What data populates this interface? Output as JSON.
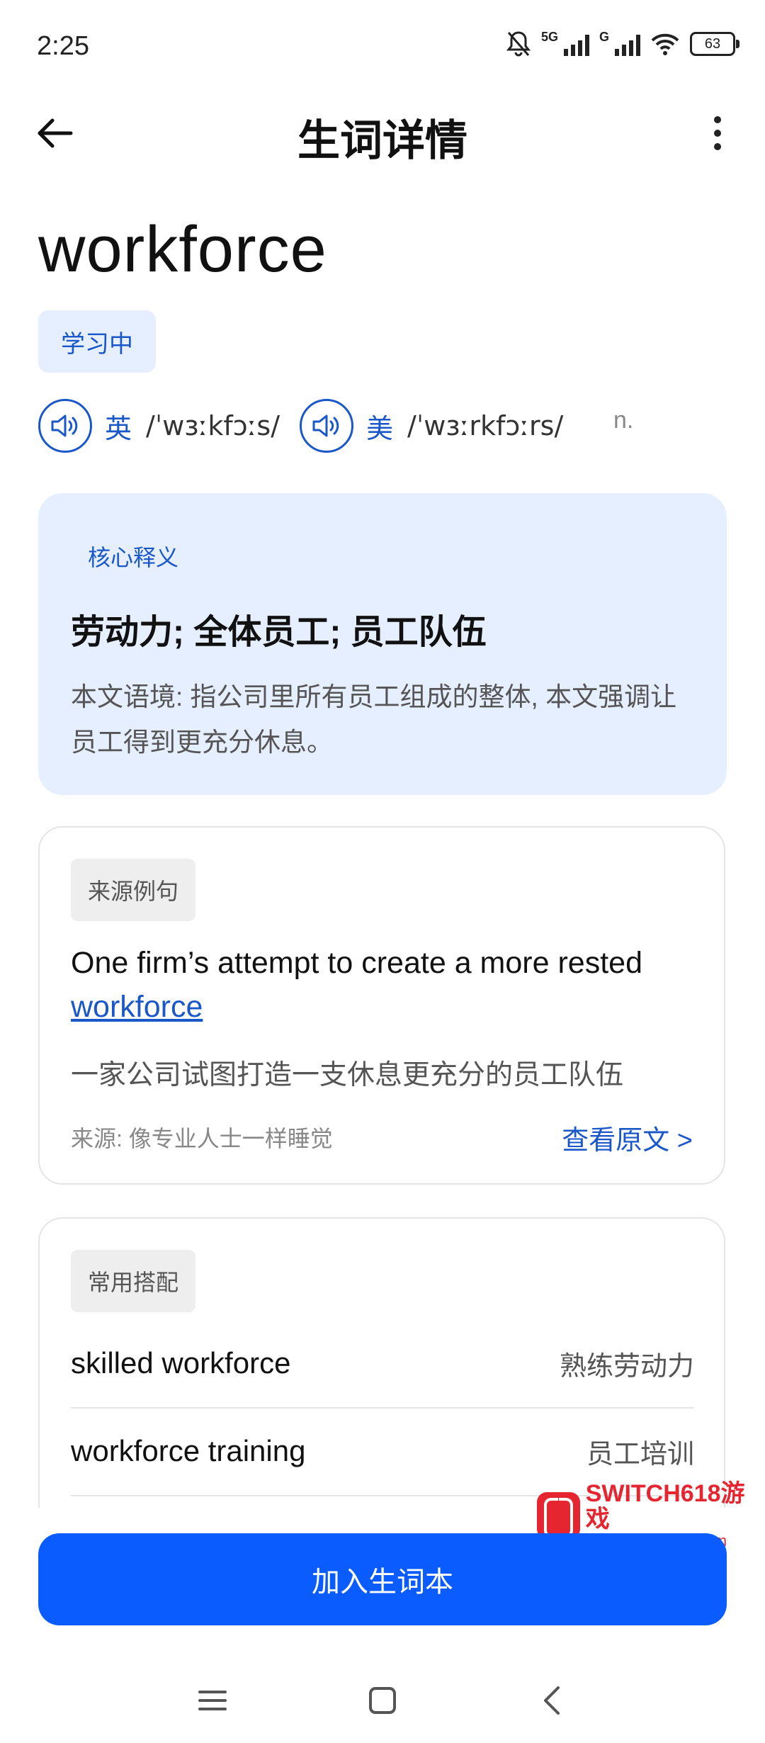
{
  "status_bar": {
    "time": "2:25",
    "network_1": "5G",
    "network_2": "G",
    "battery": "63"
  },
  "header": {
    "title": "生词详情"
  },
  "word": {
    "text": "workforce",
    "status": "学习中",
    "uk_label": "英",
    "uk_ipa": "/ˈwɜːkfɔːs/",
    "us_label": "美",
    "us_ipa": "/ˈwɜːrkfɔːrs/",
    "pos": "n."
  },
  "core": {
    "label": "核心释义",
    "meaning": "劳动力; 全体员工; 员工队伍",
    "context": "本文语境: 指公司里所有员工组成的整体, 本文强调让员工得到更充分休息。"
  },
  "example": {
    "tag": "来源例句",
    "sentence_before": "One firm’s attempt to create a more rested ",
    "sentence_highlight": "workforce",
    "translation": "一家公司试图打造一支休息更充分的员工队伍",
    "source": "来源: 像专业人士一样睡觉",
    "view_link": "查看原文 >"
  },
  "collocations": {
    "tag": "常用搭配",
    "items": [
      {
        "en": "skilled workforce",
        "zh": "熟练劳动力"
      },
      {
        "en": "workforce training",
        "zh": "员工培训"
      }
    ]
  },
  "watermark": {
    "line1": "SWITCH618游戏",
    "line2": "switch618.com"
  },
  "action": {
    "add_label": "加入生词本"
  },
  "colors": {
    "accent": "#1a57c8",
    "primary_button": "#0b5cff",
    "card_tint": "#e6efff"
  }
}
